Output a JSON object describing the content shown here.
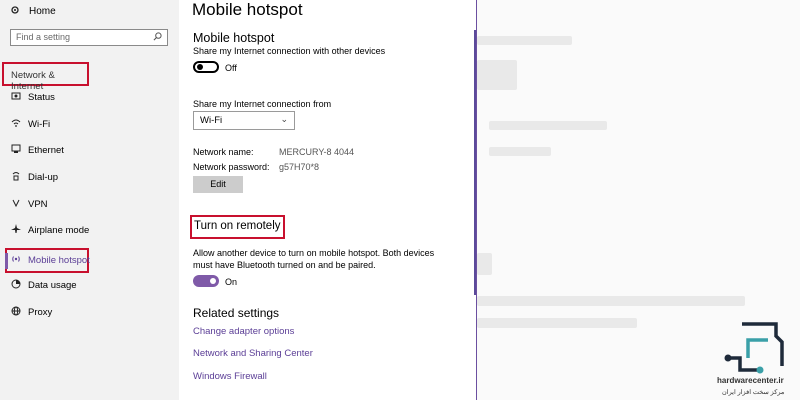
{
  "sidebar": {
    "home": {
      "icon": "gear-icon",
      "label": "Home"
    },
    "search": {
      "placeholder": "Find a setting",
      "icon": "search-icon"
    },
    "section_label": "Network & Internet",
    "items": [
      {
        "icon": "status-icon",
        "label": "Status"
      },
      {
        "icon": "wifi-icon",
        "label": "Wi-Fi"
      },
      {
        "icon": "ethernet-icon",
        "label": "Ethernet"
      },
      {
        "icon": "dialup-icon",
        "label": "Dial-up"
      },
      {
        "icon": "vpn-icon",
        "label": "VPN"
      },
      {
        "icon": "airplane-icon",
        "label": "Airplane mode"
      },
      {
        "icon": "hotspot-icon",
        "label": "Mobile hotspot",
        "active": true
      },
      {
        "icon": "data-usage-icon",
        "label": "Data usage"
      },
      {
        "icon": "globe-icon",
        "label": "Proxy"
      }
    ],
    "accent_color": "#7f5aa8"
  },
  "main": {
    "page_title": "Mobile hotspot",
    "hotspot": {
      "heading": "Mobile hotspot",
      "description": "Share my Internet connection with other devices",
      "toggle_state": "Off"
    },
    "share_from": {
      "label": "Share my Internet connection from",
      "selected": "Wi-Fi"
    },
    "network": {
      "name_label": "Network name:",
      "name_value": "MERCURY-8 4044",
      "password_label": "Network password:",
      "password_value": "g57H70*8",
      "edit_label": "Edit"
    },
    "remote": {
      "heading": "Turn on remotely",
      "description_line1": "Allow another device to turn on mobile hotspot. Both devices",
      "description_line2": "must have Bluetooth turned on and be paired.",
      "toggle_state": "On"
    },
    "related": {
      "heading": "Related settings",
      "links": [
        "Change adapter options",
        "Network and Sharing Center",
        "Windows Firewall"
      ]
    }
  },
  "watermark": {
    "name": "hardwarecenter.ir",
    "subtitle": "مرکز سخت افزار ایران"
  }
}
